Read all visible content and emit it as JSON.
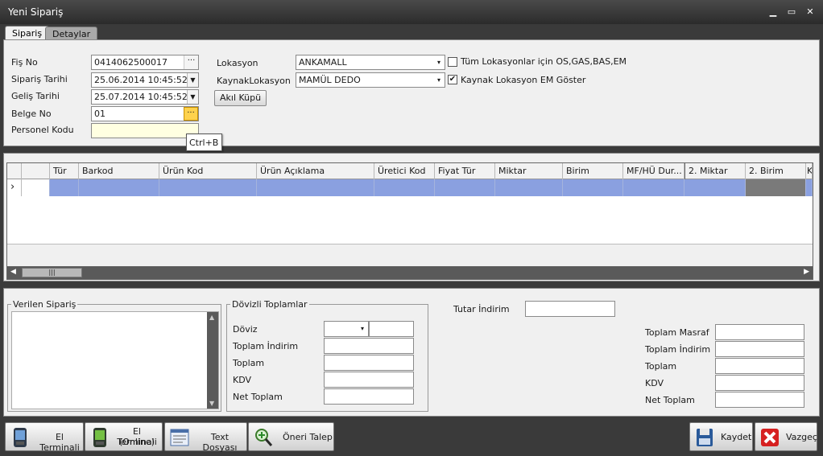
{
  "window": {
    "title": "Yeni Sipariş"
  },
  "tabs": [
    {
      "label": "Sipariş"
    },
    {
      "label": "Detaylar"
    }
  ],
  "form": {
    "fis_no": {
      "label": "Fiş No",
      "value": "0414062500017"
    },
    "siparis_tarihi": {
      "label": "Sipariş Tarihi",
      "value": "25.06.2014 10:45:52"
    },
    "gelis_tarihi": {
      "label": "Geliş Tarihi",
      "value": "25.07.2014 10:45:52"
    },
    "belge_no": {
      "label": "Belge No",
      "value": "01"
    },
    "personel_kodu": {
      "label": "Personel Kodu",
      "value": ""
    },
    "lokasyon": {
      "label": "Lokasyon",
      "value": "ANKAMALL"
    },
    "kaynak_lokasyon": {
      "label": "KaynakLokasyon",
      "value": "MAMÜL DEDO"
    },
    "tum_lokasyonlar": {
      "label": "Tüm Lokasyonlar için OS,GAS,BAS,EM",
      "checked": false
    },
    "kaynak_em": {
      "label": "Kaynak Lokasyon EM Göster",
      "checked": true
    },
    "akil_kupu": "Akıl Küpü",
    "tooltip": "Ctrl+B"
  },
  "grid": {
    "columns": [
      "Tür",
      "Barkod",
      "Ürün Kod",
      "Ürün Açıklama",
      "Üretici Kod",
      "Fiyat Tür",
      "Miktar",
      "Birim",
      "MF/HÜ Dur...",
      "2. Miktar",
      "2. Birim",
      "K"
    ],
    "row_indicator": "›"
  },
  "verilen_siparis": {
    "title": "Verilen Sipariş"
  },
  "dovizli": {
    "title": "Dövizli Toplamlar",
    "doviz": "Döviz",
    "toplam_indirim": "Toplam İndirim",
    "toplam": "Toplam",
    "kdv": "KDV",
    "net_toplam": "Net Toplam"
  },
  "tutar_indirim": "Tutar İndirim",
  "totals": {
    "toplam_masraf": "Toplam Masraf",
    "toplam_indirim": "Toplam İndirim",
    "toplam": "Toplam",
    "kdv": "KDV",
    "net_toplam": "Net Toplam"
  },
  "toolbar": {
    "el_terminali": "El Terminali",
    "el_terminali_online_1": "El Terminali",
    "el_terminali_online_2": "(Online)",
    "text_dosyasi": "Text Dosyası",
    "oneri_talep": "Öneri Talep",
    "kaydet": "Kaydet",
    "vazgec": "Vazgeç"
  }
}
